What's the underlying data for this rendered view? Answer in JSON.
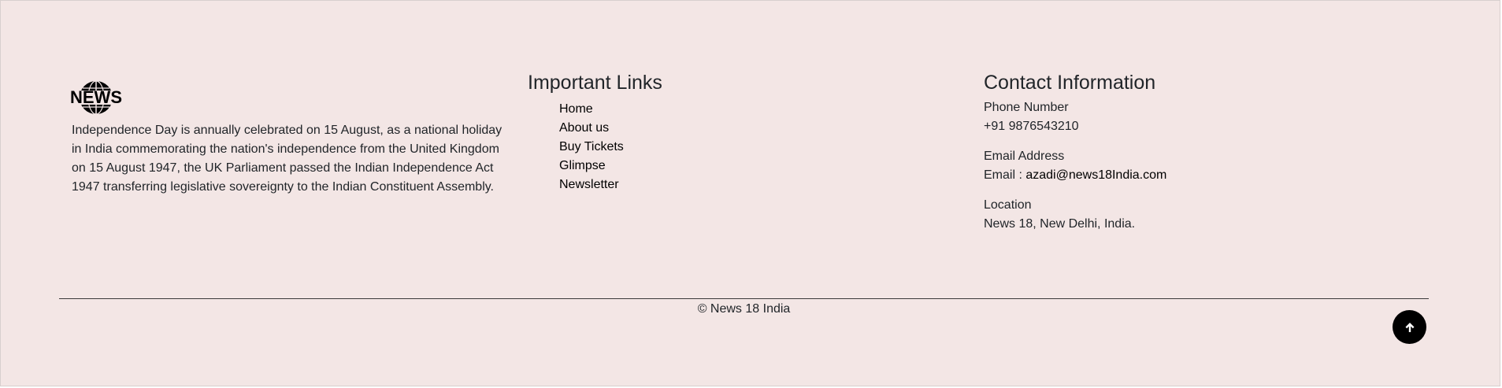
{
  "brand": {
    "logo_text": "NEWS",
    "about": "Independence Day is annually celebrated on 15 August, as a national holiday in India commemorating the nation's independence from the United Kingdom on 15 August 1947, the UK Parliament passed the Indian Independence Act 1947 transferring legislative sovereignty to the Indian Constituent Assembly."
  },
  "links": {
    "title": "Important Links",
    "items": [
      {
        "label": "Home"
      },
      {
        "label": "About us"
      },
      {
        "label": "Buy Tickets"
      },
      {
        "label": "Glimpse"
      },
      {
        "label": "Newsletter"
      }
    ]
  },
  "contact": {
    "title": "Contact Information",
    "phone_label": "Phone Number",
    "phone_value": "+91 9876543210",
    "email_label": "Email Address",
    "email_prefix": "Email : ",
    "email_value": "azadi@news18India.com",
    "location_label": "Location",
    "location_value": "News 18, New Delhi, India."
  },
  "footer": {
    "copyright": "© News 18 India",
    "scroll_top_icon": "arrow-up-icon"
  },
  "colors": {
    "background": "#f3e6e5",
    "text": "#212529",
    "link": "#000000",
    "button": "#000000"
  }
}
